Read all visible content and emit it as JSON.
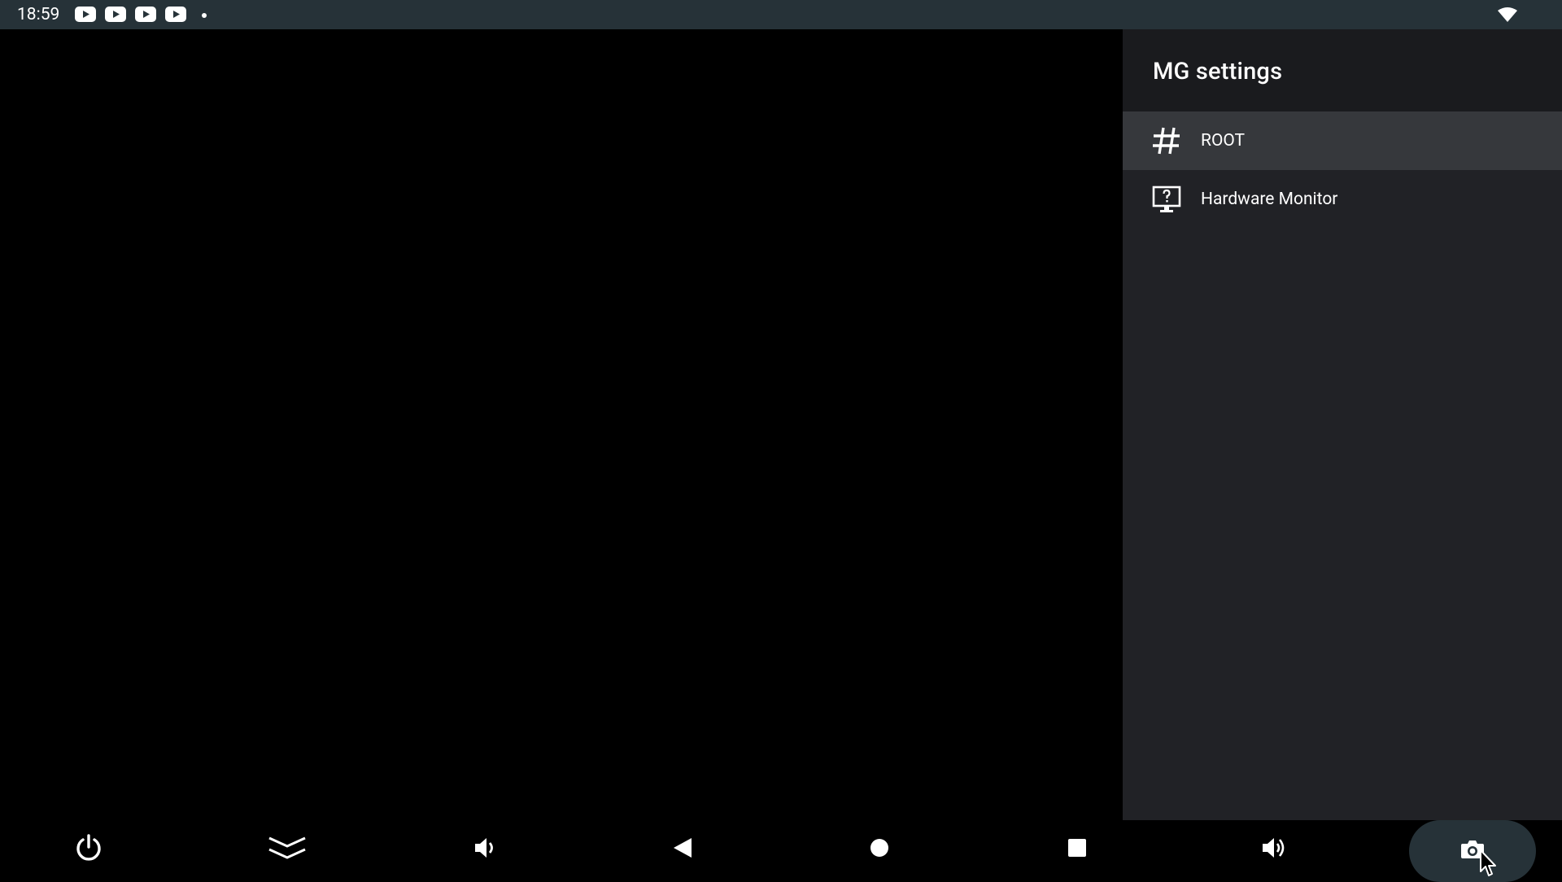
{
  "status_bar": {
    "time": "18:59",
    "notifications": [
      "youtube-icon",
      "youtube-icon",
      "youtube-icon",
      "youtube-icon"
    ],
    "background": "#263238",
    "wifi": "wifi-icon"
  },
  "settings_panel": {
    "title": "MG settings",
    "items": [
      {
        "label": "ROOT",
        "icon": "hash-icon",
        "selected": true
      },
      {
        "label": "Hardware Monitor",
        "icon": "monitor-question-icon",
        "selected": false
      }
    ],
    "background": "#212226",
    "header_background": "#1a1b1e",
    "selected_background": "#36383c"
  },
  "nav_bar": {
    "buttons": [
      {
        "icon": "power-icon"
      },
      {
        "icon": "chevrons-down-icon"
      },
      {
        "icon": "volume-down-icon"
      },
      {
        "icon": "back-icon"
      },
      {
        "icon": "home-icon"
      },
      {
        "icon": "recents-icon"
      },
      {
        "icon": "volume-up-icon"
      },
      {
        "icon": "camera-icon",
        "highlighted": true
      }
    ],
    "highlight_color": "#263238"
  }
}
